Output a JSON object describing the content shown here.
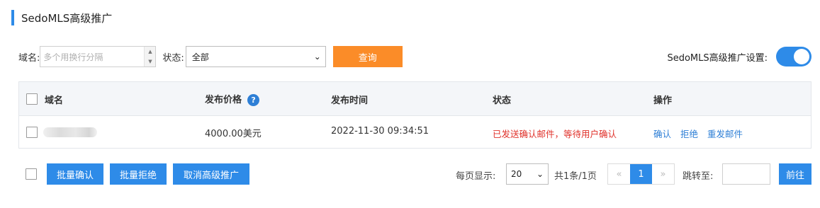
{
  "title": "SedoMLS高级推广",
  "filters": {
    "domain_label": "域名:",
    "domain_placeholder": "多个用换行分隔",
    "status_label": "状态:",
    "status_value": "全部",
    "query_button": "查询",
    "setting_label": "SedoMLS高级推广设置:",
    "setting_enabled": true
  },
  "table": {
    "columns": [
      "域名",
      "发布价格",
      "发布时间",
      "状态",
      "操作"
    ],
    "rows": [
      {
        "domain": "",
        "price": "4000.00美元",
        "time": "2022-11-30 09:34:51",
        "status": "已发送确认邮件，等待用户确认",
        "actions": [
          "确认",
          "拒绝",
          "重发邮件"
        ]
      }
    ]
  },
  "footer": {
    "batch_confirm": "批量确认",
    "batch_reject": "批量拒绝",
    "cancel_promo": "取消高级推广",
    "page_size_label": "每页显示:",
    "page_size": "20",
    "summary": "共1条/1页",
    "prev": "«",
    "current_page": "1",
    "next": "»",
    "jump_label": "跳转至:",
    "jump_value": "",
    "go_button": "前往"
  },
  "colors": {
    "accent": "#2e8be8",
    "query_button": "#fb8c28",
    "status_pending": "#e0322b",
    "link": "#2e7fd6"
  }
}
